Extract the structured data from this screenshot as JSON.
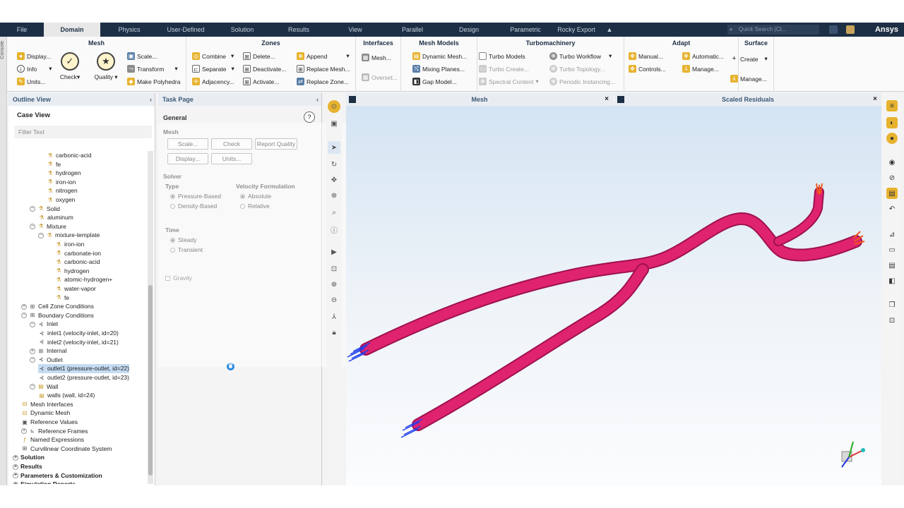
{
  "menubar": {
    "tabs": [
      "File",
      "Domain",
      "Physics",
      "User-Defined",
      "Solution",
      "Results",
      "View",
      "Parallel",
      "Design",
      "Parametric",
      "Rocky Export",
      "▲"
    ],
    "active_tab": "Domain",
    "search_placeholder": "Quick Search (Ct...",
    "brand": "Ansys"
  },
  "ribbon": {
    "mesh": {
      "title": "Mesh",
      "display": "Display...",
      "info": "Info",
      "units": "Units...",
      "check": "Check",
      "quality": "Quality",
      "scale": "Scale...",
      "transform": "Transform",
      "make_polyhedra": "Make Polyhedra"
    },
    "zones": {
      "title": "Zones",
      "combine": "Combine",
      "separate": "Separate",
      "adjacency": "Adjacency...",
      "delete": "Delete...",
      "deactivate": "Deactivate...",
      "activate": "Activate...",
      "append": "Append",
      "replace_mesh": "Replace Mesh...",
      "replace_zone": "Replace Zone..."
    },
    "interfaces": {
      "title": "Interfaces",
      "mesh": "Mesh...",
      "overset": "Overset..."
    },
    "mesh_models": {
      "title": "Mesh Models",
      "dynamic_mesh": "Dynamic Mesh...",
      "mixing_planes": "Mixing Planes...",
      "gap_model": "Gap Model..."
    },
    "turbomachinery": {
      "title": "Turbomachinery",
      "turbo_models": "Turbo Models",
      "turbo_create": "Turbo Create...",
      "spectral_content": "Spectral Content",
      "turbo_workflow": "Turbo Workflow",
      "turbo_topology": "Turbo Topology...",
      "periodic_instancing": "Periodic Instancing..."
    },
    "adapt": {
      "title": "Adapt",
      "manual": "Manual...",
      "controls": "Controls...",
      "automatic": "Automatic...",
      "manage": "Manage..."
    },
    "surface": {
      "title": "Surface",
      "create": "Create",
      "manage": "Manage..."
    }
  },
  "console_label": "Console",
  "outline": {
    "title": "Outline View",
    "collapse": "‹",
    "case_view": "Case View",
    "filter_placeholder": "Filter Text",
    "nodes": [
      {
        "label": "carbonic-acid",
        "depth": 4,
        "icon": "material"
      },
      {
        "label": "fe",
        "depth": 4,
        "icon": "material"
      },
      {
        "label": "hydrogen",
        "depth": 4,
        "icon": "material"
      },
      {
        "label": "iron-ion",
        "depth": 4,
        "icon": "material"
      },
      {
        "label": "nitrogen",
        "depth": 4,
        "icon": "material"
      },
      {
        "label": "oxygen",
        "depth": 4,
        "icon": "material"
      },
      {
        "label": "Solid",
        "depth": 2,
        "icon": "material",
        "toggle": "−"
      },
      {
        "label": "aluminum",
        "depth": 3,
        "icon": "material"
      },
      {
        "label": "Mixture",
        "depth": 2,
        "icon": "material",
        "toggle": "−"
      },
      {
        "label": "mixture-template",
        "depth": 3,
        "icon": "material",
        "toggle": "−"
      },
      {
        "label": "iron-ion",
        "depth": 5,
        "icon": "material"
      },
      {
        "label": "carbonate-ion",
        "depth": 5,
        "icon": "material"
      },
      {
        "label": "carbonic-acid",
        "depth": 5,
        "icon": "material"
      },
      {
        "label": "hydrogen",
        "depth": 5,
        "icon": "material"
      },
      {
        "label": "atomic-hydrogen+",
        "depth": 5,
        "icon": "material"
      },
      {
        "label": "water-vapor",
        "depth": 5,
        "icon": "material"
      },
      {
        "label": "fe",
        "depth": 5,
        "icon": "material"
      },
      {
        "label": "Cell Zone Conditions",
        "depth": 1,
        "icon": "zone",
        "toggle": "+"
      },
      {
        "label": "Boundary Conditions",
        "depth": 1,
        "icon": "zone",
        "toggle": "−"
      },
      {
        "label": "Inlet",
        "depth": 2,
        "icon": "bc",
        "toggle": "−"
      },
      {
        "label": "inlet1 (velocity-inlet, id=20)",
        "depth": 3,
        "icon": "bc"
      },
      {
        "label": "inlet2 (velocity-inlet, id=21)",
        "depth": 3,
        "icon": "bc"
      },
      {
        "label": "Internal",
        "depth": 2,
        "icon": "zone",
        "toggle": "+"
      },
      {
        "label": "Outlet",
        "depth": 2,
        "icon": "bc",
        "toggle": "−"
      },
      {
        "label": "outlet1 (pressure-outlet, id=22)",
        "depth": 3,
        "icon": "bc",
        "selected": true
      },
      {
        "label": "outlet2 (pressure-outlet, id=23)",
        "depth": 3,
        "icon": "bc"
      },
      {
        "label": "Wall",
        "depth": 2,
        "icon": "wall",
        "toggle": "−"
      },
      {
        "label": "walls (wall, id=24)",
        "depth": 3,
        "icon": "wall"
      },
      {
        "label": "Mesh Interfaces",
        "depth": 1,
        "icon": "mesh"
      },
      {
        "label": "Dynamic Mesh",
        "depth": 1,
        "icon": "mesh"
      },
      {
        "label": "Reference Values",
        "depth": 1,
        "icon": "ref"
      },
      {
        "label": "Reference Frames",
        "depth": 1,
        "icon": "frame",
        "toggle": "+"
      },
      {
        "label": "Named Expressions",
        "depth": 1,
        "icon": "expr"
      },
      {
        "label": "Curvilinear Coordinate System",
        "depth": 1,
        "icon": "zone"
      },
      {
        "label": "Solution",
        "depth": 0,
        "toggle": "+",
        "bold": true
      },
      {
        "label": "Results",
        "depth": 0,
        "toggle": "+",
        "bold": true
      },
      {
        "label": "Parameters & Customization",
        "depth": 0,
        "toggle": "+",
        "bold": true
      },
      {
        "label": "Simulation Reports",
        "depth": 0,
        "toggle": "+",
        "bold": true
      }
    ]
  },
  "task": {
    "title": "Task Page",
    "collapse": "‹",
    "general": "General",
    "help": "?",
    "mesh_label": "Mesh",
    "scale": "Scale...",
    "check": "Check",
    "report_quality": "Report Quality",
    "display": "Display...",
    "units": "Units...",
    "solver": "Solver",
    "type": "Type",
    "pressure_based": "Pressure-Based",
    "density_based": "Density-Based",
    "velocity_formulation": "Velocity Formulation",
    "absolute": "Absolute",
    "relative": "Relative",
    "time": "Time",
    "steady": "Steady",
    "transient": "Transient",
    "gravity": "Gravity"
  },
  "graphics": {
    "mesh_title": "Mesh",
    "residuals_title": "Scaled Residuals",
    "close": "×"
  },
  "colors": {
    "pipe": "#e0236f",
    "pipe_dark": "#9e1150",
    "inlet": "#1e3df0",
    "outlet": "#f05a1a",
    "menubar": "#1d2f45"
  }
}
